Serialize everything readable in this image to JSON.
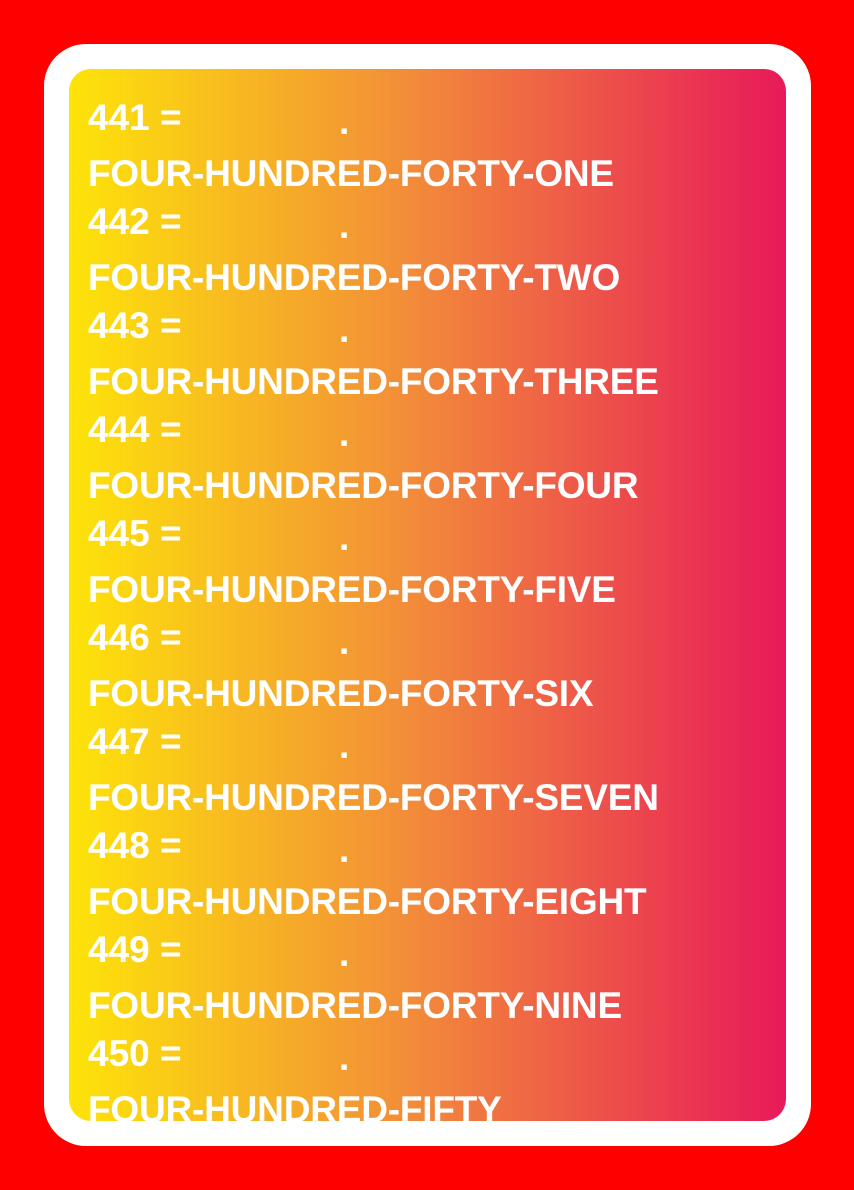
{
  "colors": {
    "background": "#ff0000",
    "card_border": "#ffffff",
    "gradient_start": "#fde409",
    "gradient_mid": "#f28b3a",
    "gradient_end": "#e8195a",
    "text": "#ffffff"
  },
  "entries": [
    {
      "number": "441 =",
      "separator": ".",
      "words": "FOUR-HUNDRED-FORTY-ONE"
    },
    {
      "number": "442 =",
      "separator": ".",
      "words": "FOUR-HUNDRED-FORTY-TWO"
    },
    {
      "number": "443 =",
      "separator": ".",
      "words": "FOUR-HUNDRED-FORTY-THREE"
    },
    {
      "number": "444 =",
      "separator": ".",
      "words": "FOUR-HUNDRED-FORTY-FOUR"
    },
    {
      "number": "445 =",
      "separator": ".",
      "words": "FOUR-HUNDRED-FORTY-FIVE"
    },
    {
      "number": "446 =",
      "separator": ".",
      "words": "FOUR-HUNDRED-FORTY-SIX"
    },
    {
      "number": "447 =",
      "separator": ".",
      "words": "FOUR-HUNDRED-FORTY-SEVEN"
    },
    {
      "number": "448 =",
      "separator": ".",
      "words": "FOUR-HUNDRED-FORTY-EIGHT"
    },
    {
      "number": "449 =",
      "separator": ".",
      "words": "FOUR-HUNDRED-FORTY-NINE"
    },
    {
      "number": "450 =",
      "separator": ".",
      "words": "FOUR-HUNDRED-FIFTY"
    }
  ]
}
